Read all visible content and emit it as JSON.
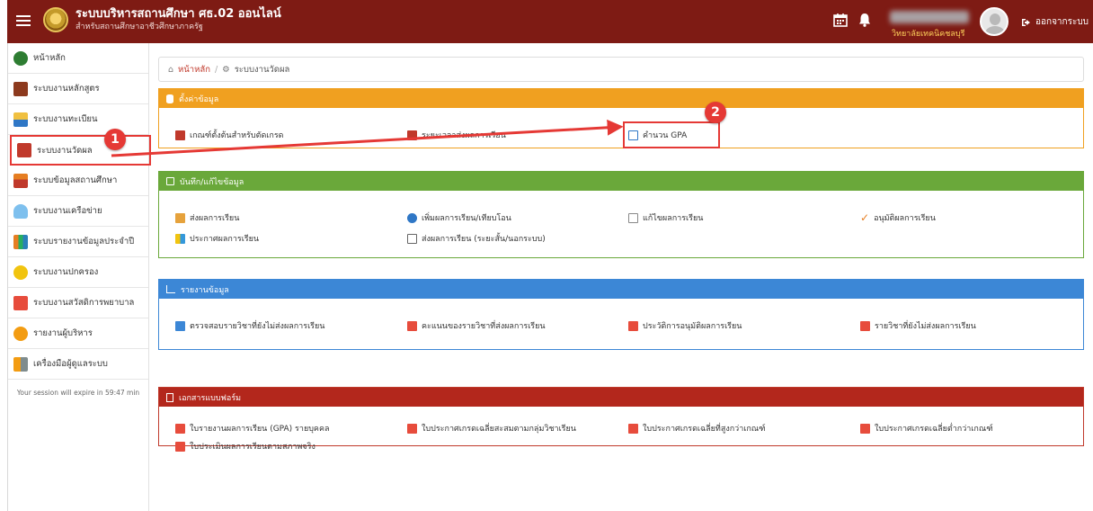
{
  "header": {
    "title": "ระบบบริหารสถานศึกษา ศธ.02 ออนไลน์",
    "subtitle": "สำหรับสถานศึกษาอาชีวศึกษาภาครัฐ",
    "org_name": "วิทยาลัยเทคนิคชลบุรี",
    "logout_label": "ออกจากระบบ"
  },
  "sidebar": {
    "items": [
      {
        "label": "หน้าหลัก",
        "icon": "dashboard-icon",
        "color": "#2e7d32"
      },
      {
        "label": "ระบบงานหลักสูตร",
        "icon": "book-icon",
        "color": "#8d3a1e"
      },
      {
        "label": "ระบบงานทะเบียน",
        "icon": "students-icon",
        "color": "#2f77c6"
      },
      {
        "label": "ระบบงานวัดผล",
        "icon": "calculator-icon",
        "color": "#c0392b"
      },
      {
        "label": "ระบบข้อมูลสถานศึกษา",
        "icon": "school-icon",
        "color": "#d35400"
      },
      {
        "label": "ระบบงานเครือข่าย",
        "icon": "cloud-icon",
        "color": "#3a9bdc"
      },
      {
        "label": "ระบบรายงานข้อมูลประจำปี",
        "icon": "report-icon",
        "color": "#e67e22"
      },
      {
        "label": "ระบบงานปกครอง",
        "icon": "person-icon",
        "color": "#f1c40f"
      },
      {
        "label": "ระบบงานสวัสดิการพยาบาล",
        "icon": "first-aid-icon",
        "color": "#e74c3c"
      },
      {
        "label": "รายงานผู้บริหาร",
        "icon": "executive-icon",
        "color": "#f39c12"
      },
      {
        "label": "เครื่องมือผู้ดูแลระบบ",
        "icon": "admin-tools-icon",
        "color": "#7f8c8d"
      }
    ],
    "session_text": "Your session will expire in 59:47 min"
  },
  "breadcrumb": {
    "home": "หน้าหลัก",
    "current": "ระบบงานวัดผล"
  },
  "panels": {
    "settings": {
      "title": "ตั้งค่าข้อมูล",
      "links": [
        "เกณฑ์ตั้งต้นสำหรับตัดเกรด",
        "ระยะเวลาส่งผลการเรียน",
        "คำนวน GPA"
      ]
    },
    "record": {
      "title": "บันทึก/แก้ไขข้อมูล",
      "links": [
        "ส่งผลการเรียน",
        "เพิ่มผลการเรียน/เทียบโอน",
        "แก้ไขผลการเรียน",
        "อนุมัติผลการเรียน",
        "ประกาศผลการเรียน",
        "ส่งผลการเรียน (ระยะสั้น/นอกระบบ)"
      ]
    },
    "reports": {
      "title": "รายงานข้อมูล",
      "links": [
        "ตรวจสอบรายวิชาที่ยังไม่ส่งผลการเรียน",
        "คะแนนของรายวิชาที่ส่งผลการเรียน",
        "ประวัติการอนุมัติผลการเรียน",
        "รายวิชาที่ยังไม่ส่งผลการเรียน"
      ]
    },
    "forms": {
      "title": "เอกสารแบบฟอร์ม",
      "links": [
        "ใบรายงานผลการเรียน (GPA) รายบุคคล",
        "ใบประกาศเกรดเฉลี่ยสะสมตามกลุ่มวิชาเรียน",
        "ใบประกาศเกรดเฉลี่ยที่สูงกว่าเกณฑ์",
        "ใบประกาศเกรดเฉลี่ยต่ำกว่าเกณฑ์",
        "ใบประเมินผลการเรียนตามสภาพจริง"
      ]
    }
  },
  "annotations": {
    "step1": "1",
    "step2": "2",
    "color": "#e53935"
  }
}
